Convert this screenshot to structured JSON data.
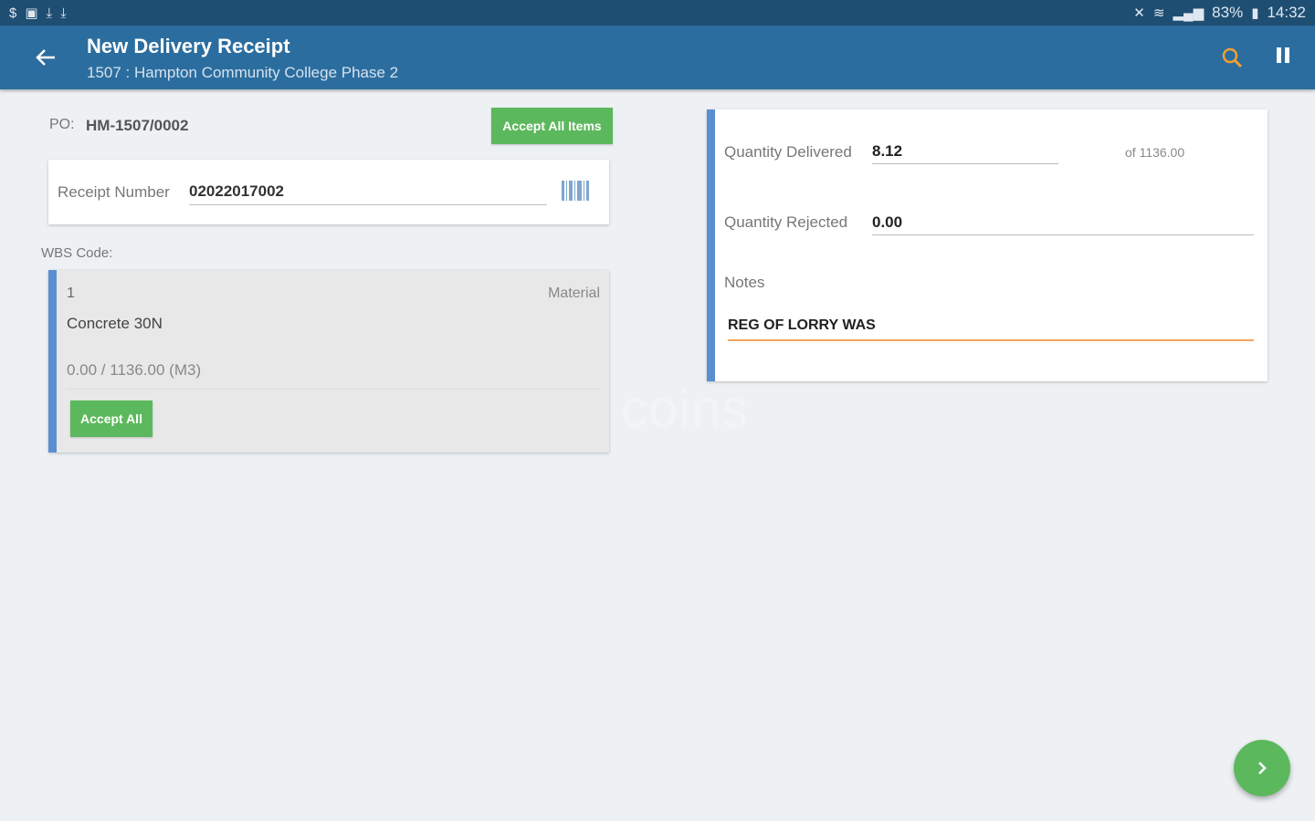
{
  "statusbar": {
    "left_icons": [
      "dollar-icon",
      "image-icon",
      "download-icon",
      "download-icon"
    ],
    "right_icons": [
      "mute-icon",
      "wifi-icon",
      "signal-icon"
    ],
    "battery": "83%",
    "time": "14:32"
  },
  "appbar": {
    "title": "New Delivery Receipt",
    "subtitle": "1507 : Hampton Community College Phase 2",
    "color": "#2b6d9e"
  },
  "po": {
    "label": "PO:",
    "value": "HM-1507/0002",
    "accept_all_items_label": "Accept All Items"
  },
  "receipt": {
    "label": "Receipt Number",
    "value": "02022017002"
  },
  "wbs": {
    "label": "WBS Code:"
  },
  "item": {
    "number": "1",
    "type": "Material",
    "description": "Concrete 30N",
    "quantity": "0.00 / 1136.00 (M3)",
    "accept_all_label": "Accept All"
  },
  "quantities": {
    "delivered_label": "Quantity Delivered",
    "delivered_value": "8.12",
    "delivered_of": "of 1136.00",
    "rejected_label": "Quantity Rejected",
    "rejected_value": "0.00",
    "notes_label": "Notes",
    "notes_value": "REG OF LORRY WAS"
  },
  "watermark": "coins",
  "colors": {
    "accent_green": "#5cb85c",
    "card_border_blue": "#5b8ed1",
    "notes_underline": "#f4a460",
    "search_icon": "#f0a030"
  }
}
